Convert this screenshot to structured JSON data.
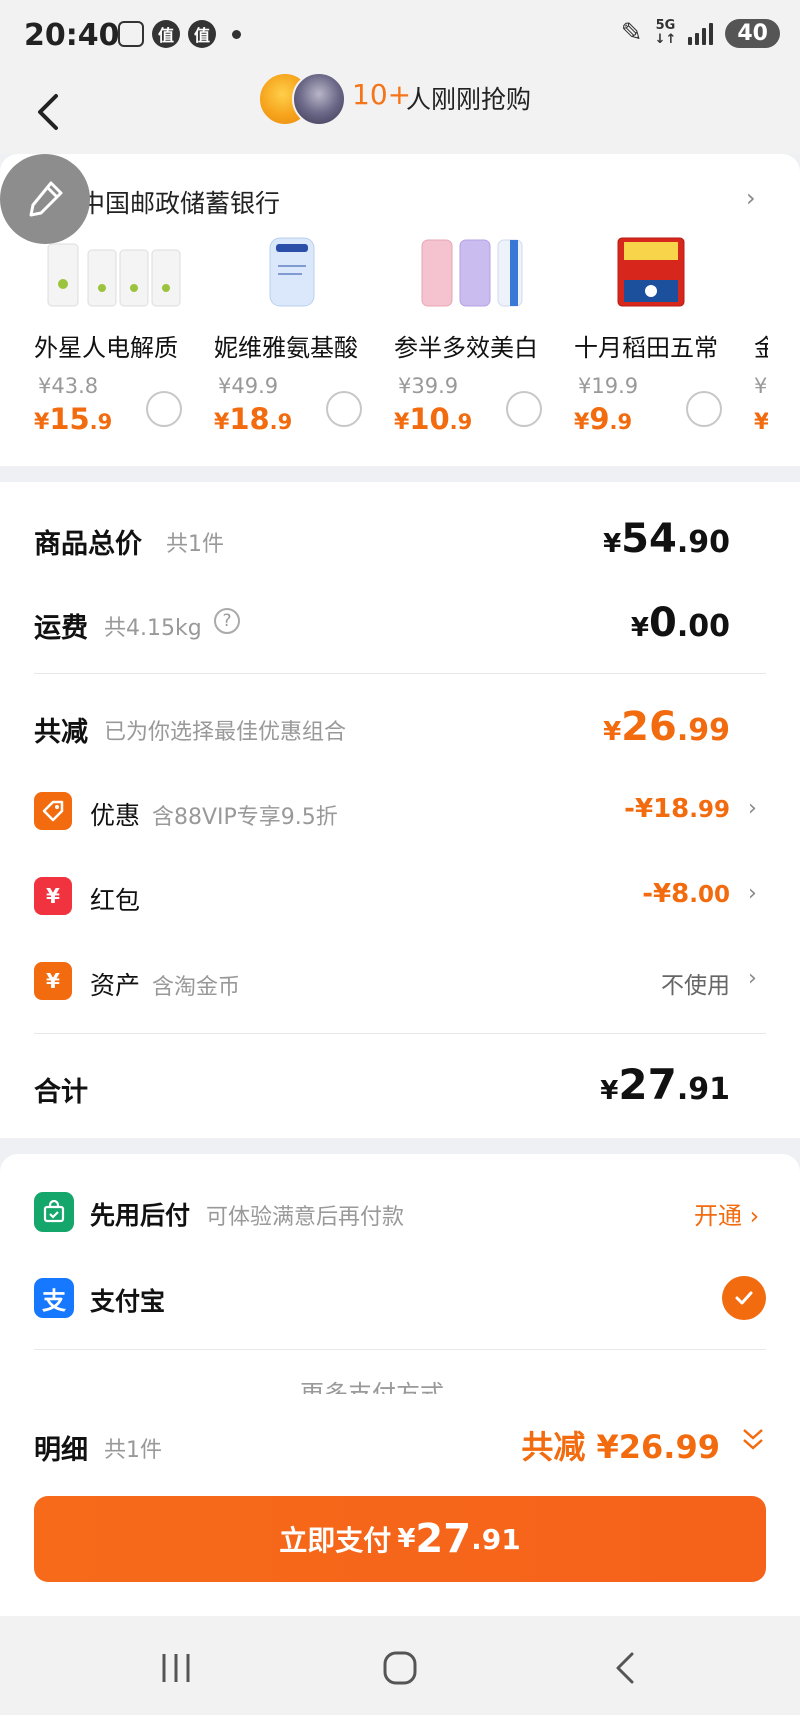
{
  "status_bar": {
    "time": "20:40",
    "badge_a": "值",
    "badge_b": "值",
    "network": "5G",
    "battery": "40"
  },
  "header": {
    "buyers_count": "10+",
    "buyers_text": "人刚刚抢购"
  },
  "recommend": {
    "bank": "中国邮政储蓄银行",
    "products": [
      {
        "name": "外星人电解质",
        "orig": "¥43.8",
        "price_yen": "¥",
        "price_int": "15",
        "price_dec": ".9"
      },
      {
        "name": "妮维雅氨基酸",
        "orig": "¥49.9",
        "price_yen": "¥",
        "price_int": "18",
        "price_dec": ".9"
      },
      {
        "name": "参半多效美白",
        "orig": "¥39.9",
        "price_yen": "¥",
        "price_int": "10",
        "price_dec": ".9"
      },
      {
        "name": "十月稻田五常",
        "orig": "¥19.9",
        "price_yen": "¥",
        "price_int": "9",
        "price_dec": ".9"
      },
      {
        "name": "金",
        "orig": "¥",
        "price_yen": "¥",
        "price_int": "",
        "price_dec": ""
      }
    ]
  },
  "summary": {
    "goods_total_label": "商品总价",
    "goods_total_sub": "共1件",
    "goods_total_yen": "¥",
    "goods_total_int": "54",
    "goods_total_dec": ".90",
    "shipping_label": "运费",
    "shipping_sub": "共4.15kg",
    "shipping_yen": "¥",
    "shipping_int": "0",
    "shipping_dec": ".00",
    "reduce_label": "共减",
    "reduce_sub": "已为你选择最佳优惠组合",
    "reduce_yen": "¥",
    "reduce_int": "26",
    "reduce_dec": ".99",
    "discounts": [
      {
        "label": "优惠",
        "sub": "含88VIP专享9.5折",
        "value_pre": "-¥",
        "value_int": "18",
        "value_dec": ".99"
      },
      {
        "label": "红包",
        "sub": "",
        "value_pre": "-¥",
        "value_int": "8",
        "value_dec": ".00"
      },
      {
        "label": "资产",
        "sub": "含淘金币",
        "value_text": "不使用"
      }
    ],
    "icon_glyphs": {
      "hongbao": "¥",
      "asset": "¥"
    },
    "total_label": "合计",
    "total_yen": "¥",
    "total_int": "27",
    "total_dec": ".91"
  },
  "payment": {
    "later_label": "先用后付",
    "later_sub": "可体验满意后再付款",
    "later_action": "开通",
    "alipay_label": "支付宝",
    "alipay_glyph": "支",
    "more_methods": "更多支付方式"
  },
  "bottom": {
    "detail_label": "明细",
    "detail_sub": "共1件",
    "total_discount": "共减 ¥26.99",
    "pay_text": "立即支付",
    "pay_yen": "¥",
    "pay_int": "27",
    "pay_dec": ".91"
  },
  "colors": {
    "accent": "#f26b0f",
    "alipay": "#1677ff",
    "pay_later": "#14a66b",
    "hongbao": "#f0333f",
    "asset": "#f26b0f"
  }
}
